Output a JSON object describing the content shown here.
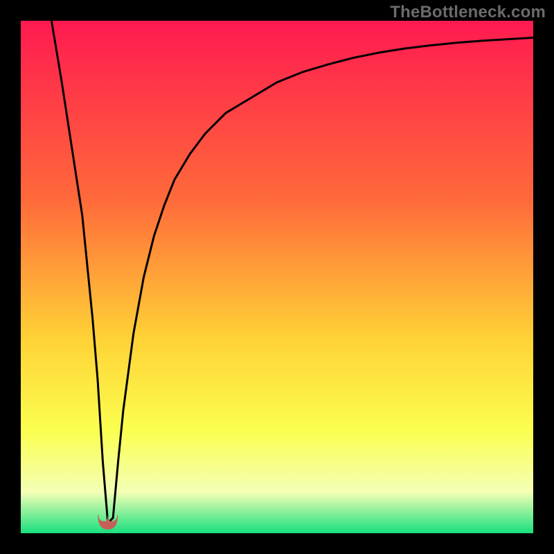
{
  "watermark": "TheBottleneck.com",
  "colors": {
    "frame": "#000000",
    "grad_top": "#ff1a50",
    "grad_mid1": "#ff6a3a",
    "grad_mid2": "#ffd236",
    "grad_mid3": "#fbff50",
    "grad_mid4": "#f4ffb6",
    "grad_bottom": "#18e07e",
    "curve": "#000000",
    "marker": "#c46058"
  },
  "chart_data": {
    "type": "line",
    "title": "",
    "xlabel": "",
    "ylabel": "",
    "xlim": [
      0,
      100
    ],
    "ylim": [
      0,
      100
    ],
    "optimum_x": 17,
    "series": [
      {
        "name": "bottleneck-curve",
        "x": [
          6,
          8,
          10,
          12,
          14,
          15,
          16,
          17,
          18,
          19,
          20,
          22,
          24,
          26,
          28,
          30,
          33,
          36,
          40,
          45,
          50,
          55,
          60,
          65,
          70,
          75,
          80,
          85,
          90,
          95,
          100
        ],
        "y": [
          100,
          88,
          75,
          62,
          42,
          30,
          14,
          2,
          3,
          14,
          24,
          39,
          50,
          58,
          64,
          69,
          74,
          78,
          82,
          85,
          88,
          90,
          91.5,
          92.8,
          93.8,
          94.6,
          95.2,
          95.7,
          96.1,
          96.4,
          96.7
        ]
      }
    ],
    "annotations": [
      {
        "label": "optimum-marker",
        "x": 17,
        "y": 2
      }
    ]
  }
}
